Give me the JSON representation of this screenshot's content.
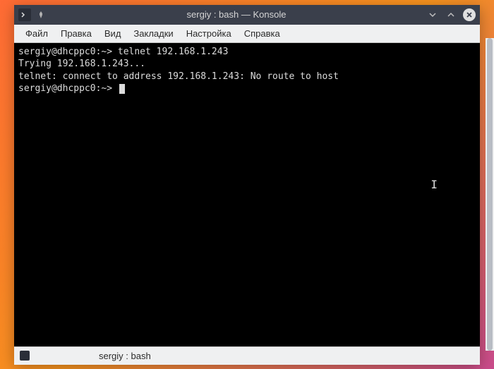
{
  "window": {
    "title": "sergiy : bash — Konsole"
  },
  "menubar": {
    "items": [
      "Файл",
      "Правка",
      "Вид",
      "Закладки",
      "Настройка",
      "Справка"
    ]
  },
  "terminal": {
    "lines": [
      "sergiy@dhcppc0:~> telnet 192.168.1.243",
      "Trying 192.168.1.243...",
      "telnet: connect to address 192.168.1.243: No route to host",
      "sergiy@dhcppc0:~> "
    ]
  },
  "statusbar": {
    "tab_label": "sergiy : bash"
  }
}
